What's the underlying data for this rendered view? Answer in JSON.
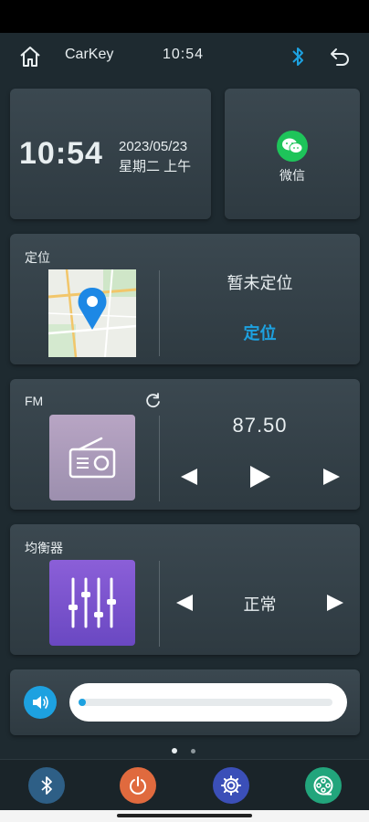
{
  "status_bar": {},
  "top_bar": {
    "home_icon": "home-icon",
    "app_name": "CarKey",
    "time": "10:54",
    "bluetooth_icon": "bluetooth-icon",
    "back_icon": "back-icon"
  },
  "clock_card": {
    "time": "10:54",
    "date": "2023/05/23",
    "weekday": "星期二 上午"
  },
  "wechat_card": {
    "label": "微信",
    "icon": "wechat-icon"
  },
  "location_card": {
    "title": "定位",
    "status": "暂未定位",
    "action": "定位",
    "map_icon": "map-thumbnail"
  },
  "fm_card": {
    "title": "FM",
    "frequency": "87.50",
    "refresh_icon": "refresh-icon",
    "radio_icon": "radio-icon"
  },
  "equalizer_card": {
    "title": "均衡器",
    "mode": "正常",
    "equalizer_icon": "equalizer-icon"
  },
  "volume_card": {
    "volume_icon": "speaker-icon",
    "level": 0.03
  },
  "pager": {
    "count": 2,
    "active": 0
  },
  "bottom_bar": {
    "items": [
      "bluetooth-icon",
      "power-icon",
      "settings-icon",
      "film-reel-icon"
    ],
    "colors": [
      "#2e5f86",
      "#e06a3e",
      "#3b4fb8",
      "#22a57c"
    ]
  },
  "colors": {
    "accent": "#1da1e0",
    "background": "#1e2a30"
  }
}
